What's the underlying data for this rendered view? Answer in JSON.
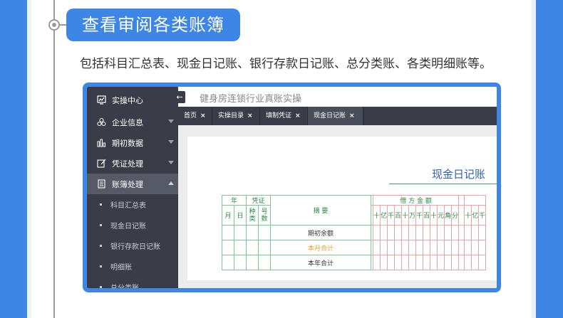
{
  "heading": "查看审阅各类账簿",
  "description": "包括科目汇总表、现金日记账、银行存款日记账、总分类账、各类明细账等。",
  "app": {
    "back_label": "←",
    "title": "健身房连锁行业真账实操"
  },
  "sidebar": {
    "items": [
      {
        "label": "实操中心",
        "icon": "chart-board-icon"
      },
      {
        "label": "企业信息",
        "icon": "org-icon"
      },
      {
        "label": "期初数据",
        "icon": "bar-chart-icon"
      },
      {
        "label": "凭证处理",
        "icon": "edit-icon"
      },
      {
        "label": "账簿处理",
        "icon": "book-icon"
      }
    ],
    "sub_items": [
      "科目汇总表",
      "现金日记账",
      "银行存款日记账",
      "明细账",
      "总分类账"
    ]
  },
  "tabs": [
    {
      "label": "首页",
      "close": "×"
    },
    {
      "label": "实操目录",
      "close": "×"
    },
    {
      "label": "填制凭证",
      "close": "×"
    },
    {
      "label": "现金日记账",
      "close": "×"
    }
  ],
  "ledger": {
    "title": "现金日记账",
    "headers": {
      "year": "年",
      "voucher": "凭证",
      "month": "月",
      "day": "日",
      "kind": "种类",
      "number": "号数",
      "summary": "摘 要",
      "debit": "借 方 金 额",
      "digits": [
        "十",
        "亿",
        "千",
        "百",
        "十",
        "万",
        "千",
        "百",
        "十",
        "元",
        "角",
        "分"
      ],
      "digits2": [
        "十",
        "亿",
        "千"
      ]
    },
    "rows": [
      "期初余额",
      "本月合计",
      "本年合计"
    ]
  },
  "colors": {
    "frame": "#3e86e6",
    "sidebar": "#3a3d48",
    "ledger_title": "#2e62b8",
    "grid_green": "#7cc98f",
    "grid_red": "#f2a0a0",
    "highlight_row": "#f0a020"
  }
}
